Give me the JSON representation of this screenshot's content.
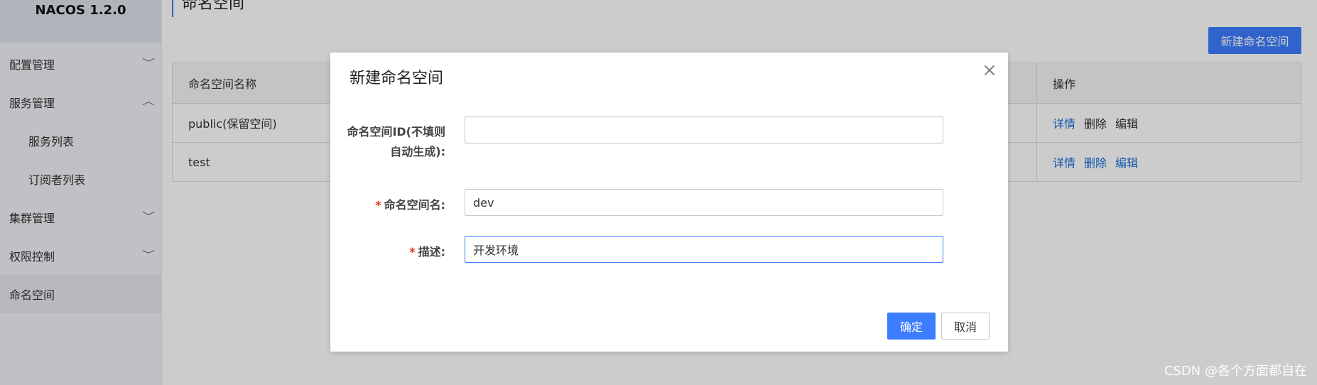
{
  "brand": {
    "title": "NACOS 1.2.0"
  },
  "sidebar": {
    "items": [
      {
        "label": "配置管理",
        "chevron": "v"
      },
      {
        "label": "服务管理",
        "chevron": "^"
      },
      {
        "label": "服务列表",
        "chevron": ""
      },
      {
        "label": "订阅者列表",
        "chevron": ""
      },
      {
        "label": "集群管理",
        "chevron": "v"
      },
      {
        "label": "权限控制",
        "chevron": "v"
      },
      {
        "label": "命名空间",
        "chevron": ""
      }
    ]
  },
  "page": {
    "title": "命名空间",
    "new_button": "新建命名空间"
  },
  "table": {
    "headers": {
      "name": "命名空间名称",
      "ops": "操作"
    },
    "rows": [
      {
        "name": "public(保留空间)",
        "detail": "详情",
        "delete": "删除",
        "edit": "编辑"
      },
      {
        "name": "test",
        "detail": "详情",
        "delete": "删除",
        "edit": "编辑"
      }
    ]
  },
  "dialog": {
    "title": "新建命名空间",
    "close_icon": "×",
    "id_label_line1": "命名空间ID(不填则",
    "id_label_line2": "自动生成):",
    "id_value": "",
    "name_label": "命名空间名:",
    "name_value": "dev",
    "desc_label": "描述:",
    "desc_value": "开发环境",
    "required_mark": "*",
    "ok": "确定",
    "cancel": "取消"
  },
  "watermark": "CSDN @各个方面都自在",
  "colors": {
    "primary": "#3c7cff",
    "link": "#1a6fd8",
    "required": "#e0331f"
  }
}
